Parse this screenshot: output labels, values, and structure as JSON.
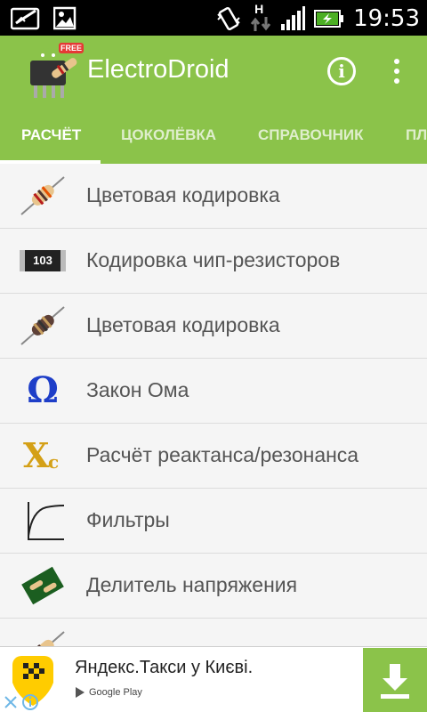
{
  "status_bar": {
    "time": "19:53",
    "network_label": "H",
    "icons": [
      "screenshot-icon",
      "gallery-icon",
      "vibrate-icon",
      "data-activity-icon",
      "signal-icon",
      "battery-charging-icon"
    ]
  },
  "app_bar": {
    "title": "ElectroDroid",
    "logo_badge": "FREE",
    "info_icon_glyph": "i",
    "accent_color": "#8bc34a"
  },
  "tabs": [
    {
      "label": "РАСЧЁТ",
      "active": true
    },
    {
      "label": "ЦОКОЛЁВКА",
      "active": false
    },
    {
      "label": "СПРАВОЧНИК",
      "active": false
    },
    {
      "label": "ПЛ",
      "active": false
    }
  ],
  "list": {
    "items": [
      {
        "label": "Цветовая кодировка",
        "icon": "resistor-icon"
      },
      {
        "label": "Кодировка чип-резисторов",
        "icon": "smd-resistor-icon",
        "icon_text": "103"
      },
      {
        "label": "Цветовая кодировка",
        "icon": "inductor-icon"
      },
      {
        "label": "Закон Ома",
        "icon": "omega-icon",
        "icon_text": "Ω"
      },
      {
        "label": "Расчёт реактанса/резонанса",
        "icon": "reactance-icon",
        "icon_text": "X",
        "icon_sub": "c"
      },
      {
        "label": "Фильтры",
        "icon": "filter-curve-icon"
      },
      {
        "label": "Делитель напряжения",
        "icon": "voltage-divider-board-icon"
      },
      {
        "label": "",
        "icon": "resistor-icon"
      }
    ]
  },
  "ad": {
    "title": "Яндекс.Такси у Києві.",
    "store": "Google Play",
    "download_icon": "download-icon"
  }
}
